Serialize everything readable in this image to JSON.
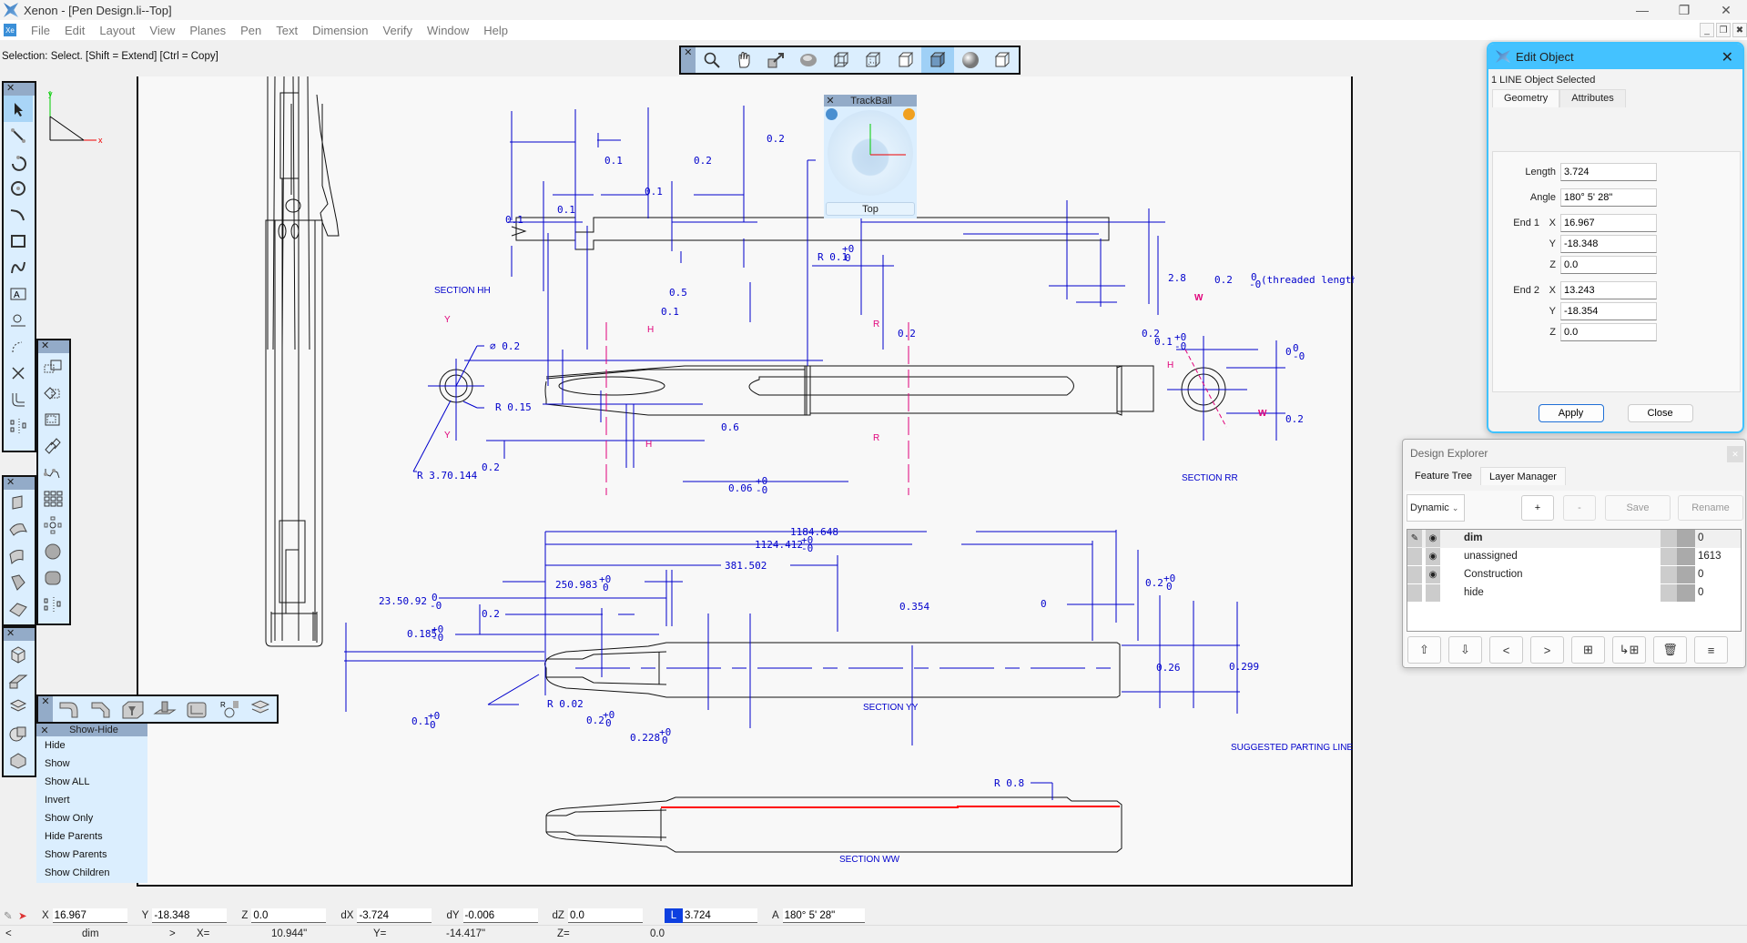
{
  "window": {
    "title": "Xenon - [Pen Design.li--Top]",
    "controls": [
      "minimize",
      "restore",
      "close"
    ]
  },
  "menu": [
    "File",
    "Edit",
    "Layout",
    "View",
    "Planes",
    "Pen",
    "Text",
    "Dimension",
    "Verify",
    "Window",
    "Help"
  ],
  "status_message": "Selection: Select. [Shift = Extend] [Ctrl = Copy]",
  "view_toolbar": {
    "items": [
      {
        "icon": "zoom-icon"
      },
      {
        "icon": "pan-hand-icon"
      },
      {
        "icon": "zoom-extents-icon"
      },
      {
        "icon": "rotate-sphere-icon"
      },
      {
        "icon": "wireframe-icon"
      },
      {
        "icon": "hidden-lines-icon"
      },
      {
        "icon": "hidden-removed-icon"
      },
      {
        "icon": "shaded-icon",
        "active": true
      },
      {
        "icon": "rendered-icon"
      },
      {
        "icon": "iso-view-icon"
      }
    ]
  },
  "trackball": {
    "title": "TrackBall",
    "view": "Top"
  },
  "drawing": {
    "section_labels": [
      "SECTION HH",
      "SECTION RR",
      "SECTION YY",
      "SECTION WW"
    ],
    "note": "SUGGESTED PARTING LINE FOR MOULD",
    "top_dims": [
      "0.2",
      "0.1",
      "0.2",
      "0.1",
      "0.1",
      "0.1"
    ],
    "hh_dims": {
      "r_top": "R 0.1",
      "r_top_tol": "+0",
      "r_top_tol2": "0",
      "d05": "0.5",
      "d01": "0.1",
      "d28": "2.8",
      "d02a": "0.2",
      "d02b": "0.2",
      "threaded": "0.2",
      "threaded_tol_top": "0",
      "threaded_tol_bot": "-0",
      "threaded_note": "(threaded length)",
      "d01b": "0.1",
      "d01b_tol_top": "+0",
      "d01b_tol_bot": "-0",
      "dia": "⌀ 0.2",
      "r015": "R 0.15",
      "r370": "R 3.70.144",
      "d02c": "0.2",
      "d06": "0.6",
      "d006": "0.06",
      "d006_tol_top": "+0",
      "d006_tol_bot": "-0",
      "rr_top": "0",
      "rr_tol_top": "0",
      "rr_tol_bot": "-0",
      "rr_02": "0.2"
    },
    "section_markers": {
      "h": "H",
      "r": "R",
      "w": "W",
      "y": "Y"
    },
    "yy_dims": {
      "d1184": "1184.648",
      "d1124": "1124.412",
      "d1124_tol_top": "+0",
      "d1124_tol_bot": "-0",
      "d381": "381.502",
      "d250": "250.983",
      "d250_tol_top": "+0",
      "d250_tol_bot": "0",
      "d2350": "23.50.92",
      "d2350_tol_top": "0",
      "d2350_tol_bot": "-0",
      "d02": "0.2",
      "d0185": "0.185",
      "d0185_tol_top": "+0",
      "d0185_tol_bot": "-0",
      "d01": "0.1",
      "d01_tol_top": "+0",
      "d01_tol_bot": "0",
      "r002": "R 0.02",
      "d02b": "0.2",
      "d02b_tol_top": "+0",
      "d02b_tol_bot": "0",
      "d0228": "0.228",
      "d0228_tol_top": "+0",
      "d0228_tol_bot": "0",
      "d0354": "0.354",
      "d0": "0",
      "d02c": "0.2",
      "d02c_tol_top": "+0",
      "d02c_tol_bot": "0",
      "d026": "0.26",
      "d0299": "0.299"
    },
    "ww_dims": {
      "r08": "R 0.8"
    }
  },
  "left_toolbars": {
    "draw": [
      "select-arrow-icon",
      "line-icon",
      "arc-icon",
      "circle-icon",
      "fillet-curve-icon",
      "rectangle-icon",
      "spline-icon",
      "text-box-icon",
      "dimension-icon",
      "arc-dim-icon",
      "intersect-icon",
      "offset-icon",
      "mirror-icon"
    ],
    "transform": [
      "move-icon",
      "rotate-icon",
      "scale-icon",
      "copy-icon",
      "chain-icon",
      "grid-array-icon",
      "polar-array-icon",
      "sphere-points-icon",
      "drum-icon",
      "mirror-copy-icon"
    ],
    "surface": [
      "plane-icon",
      "surface-icon",
      "extrude-surface-icon",
      "trim-surface-icon",
      "blend-surface-icon"
    ],
    "solid": [
      "box-icon",
      "extrude-solid-icon",
      "revolve-icon",
      "boolean-icon",
      "shell-icon"
    ],
    "features": [
      "fillet-edge-icon",
      "chamfer-icon",
      "counterbore-icon",
      "boss-icon",
      "pocket-icon",
      "radius-tool-icon",
      "loft-icon"
    ]
  },
  "show_hide": {
    "title": "Show-Hide",
    "items": [
      "Hide",
      "Show",
      "Show ALL",
      "Invert",
      "Show Only",
      "Hide Parents",
      "Show Parents",
      "Show Children"
    ]
  },
  "edit_object": {
    "title": "Edit Object",
    "selection": "1 LINE Object Selected",
    "tabs": [
      "Geometry",
      "Attributes"
    ],
    "active_tab": "Geometry",
    "fields": {
      "length_label": "Length",
      "length": "3.724",
      "angle_label": "Angle",
      "angle": "180° 5' 28\"",
      "end1_label": "End 1",
      "end2_label": "End 2",
      "x_label": "X",
      "y_label": "Y",
      "z_label": "Z",
      "end1_x": "16.967",
      "end1_y": "-18.348",
      "end1_z": "0.0",
      "end2_x": "13.243",
      "end2_y": "-18.354",
      "end2_z": "0.0"
    },
    "apply": "Apply",
    "close": "Close"
  },
  "design_explorer": {
    "title": "Design Explorer",
    "tabs": [
      "Feature Tree",
      "Layer Manager"
    ],
    "active_tab": "Layer Manager",
    "filter": "Dynamic",
    "buttons": {
      "add": "+",
      "remove": "-",
      "save": "Save",
      "rename": "Rename"
    },
    "layers": [
      {
        "name": "dim",
        "active": true,
        "visible": true,
        "count": "0"
      },
      {
        "name": "unassigned",
        "active": false,
        "visible": true,
        "count": "1613"
      },
      {
        "name": "Construction",
        "active": false,
        "visible": true,
        "count": "0"
      },
      {
        "name": "hide",
        "active": false,
        "visible": false,
        "count": "0"
      }
    ],
    "bottom_buttons": [
      "move-up-icon",
      "move-down-icon",
      "prev-icon",
      "next-icon",
      "add-layer-icon",
      "merge-layer-icon",
      "delete-icon",
      "menu-icon"
    ]
  },
  "coord_bar": {
    "x_label": "X",
    "x": "16.967",
    "y_label": "Y",
    "y": "-18.348",
    "z_label": "Z",
    "z": "0.0",
    "dx_label": "dX",
    "dx": "-3.724",
    "dy_label": "dY",
    "dy": "-0.006",
    "dz_label": "dZ",
    "dz": "0.0",
    "l_label": "L",
    "l": "3.724",
    "a_label": "A",
    "a": "180° 5' 28\""
  },
  "info_bar": {
    "prev": "<",
    "layer": "dim",
    "next": ">",
    "x_label": "X=",
    "x": "10.944\"",
    "y_label": "Y=",
    "y": "-14.417\"",
    "z_label": "Z=",
    "z": "0.0"
  },
  "colors": {
    "dimension": "#0000cc",
    "section_marker": "#e0007a",
    "selected_line": "#ff0000",
    "dialog_accent": "#44c2ff",
    "toolbar_bg": "#dbeefe"
  }
}
